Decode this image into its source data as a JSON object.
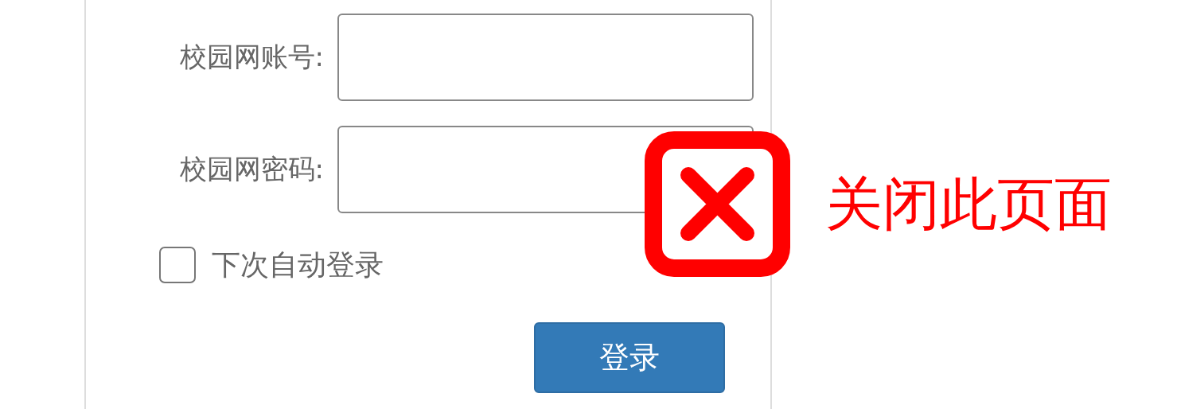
{
  "login_form": {
    "fields": [
      {
        "label": "校园网账号:"
      },
      {
        "label": "校园网密码:"
      }
    ],
    "auto_login": {
      "label": "下次自动登录",
      "checked": false
    },
    "submit_button": {
      "label": "登录"
    }
  },
  "close_overlay": {
    "label": "关闭此页面"
  }
}
